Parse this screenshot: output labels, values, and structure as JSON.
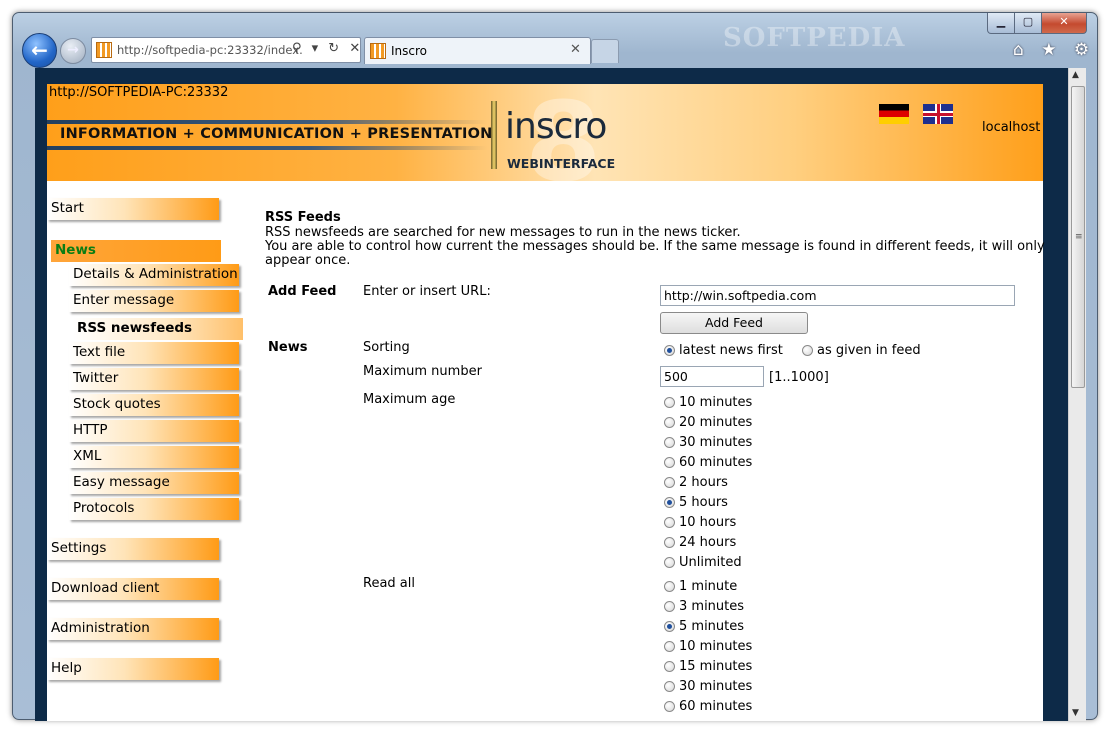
{
  "browser": {
    "address": "http://softpedia-pc:23332/index.",
    "address_icons": "⚲ ▾ ↻ ✕",
    "tab_title": "Inscro",
    "tab_close": "✕",
    "back": "←",
    "forward": "→",
    "right_icons": "⌂ ★ ⚙",
    "window_min": "▁",
    "window_max": "▢",
    "window_close": "✕",
    "watermark": "SOFTPEDIA"
  },
  "header": {
    "host": "http://SOFTPEDIA-PC:23332",
    "tagline": "INFORMATION + COMMUNICATION + PRESENTATION",
    "logo": "inscro",
    "logo_sub": "WEBINTERFACE",
    "logo_bg": "8",
    "user": "localhost"
  },
  "nav": {
    "start": "Start",
    "news": "News",
    "sub": [
      "Details & Administration",
      "Enter message",
      "RSS newsfeeds",
      "Text file",
      "Twitter",
      "Stock quotes",
      "HTTP",
      "XML",
      "Easy message",
      "Protocols"
    ],
    "settings": "Settings",
    "download": "Download client",
    "administration": "Administration",
    "help": "Help"
  },
  "main": {
    "title": "RSS Feeds",
    "desc1": "RSS newsfeeds are searched for new messages to run in the news ticker.",
    "desc2": "You are able to control how current the messages should be. If the same message is found in different feeds, it will only",
    "desc3": "appear once.",
    "add_feed_label": "Add Feed",
    "url_label": "Enter or insert URL:",
    "url_value": "http://win.softpedia.com",
    "add_button": "Add Feed",
    "news_label": "News",
    "sorting_label": "Sorting",
    "sorting_options": [
      "latest news first",
      "as given in feed"
    ],
    "max_number_label": "Maximum number",
    "max_number_value": "500",
    "max_number_range": "[1..1000]",
    "max_age_label": "Maximum age",
    "max_age_options": [
      "10 minutes",
      "20 minutes",
      "30 minutes",
      "60 minutes",
      "2 hours",
      "5 hours",
      "10 hours",
      "24 hours",
      "Unlimited"
    ],
    "read_all_label": "Read all",
    "read_all_options": [
      "1 minute",
      "3 minutes",
      "5 minutes",
      "10 minutes",
      "15 minutes",
      "30 minutes",
      "60 minutes"
    ]
  },
  "colors": {
    "accent_orange": "#ff9b16",
    "active_text": "#0a7d14",
    "frame_navy": "#0d2a48"
  }
}
